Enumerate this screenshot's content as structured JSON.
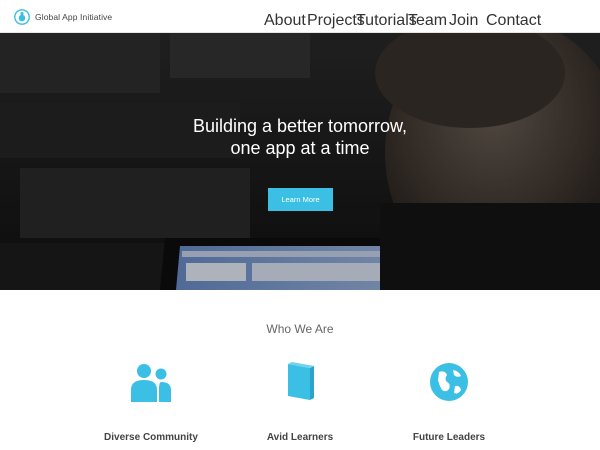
{
  "nav": {
    "brand": "Global App Initiative",
    "links": [
      "About",
      "Projects",
      "Tutorials",
      "Team",
      "Join",
      "Contact"
    ]
  },
  "hero": {
    "title_line1": "Building a better tomorrow,",
    "title_line2": "one app at a time",
    "cta_label": "Learn More"
  },
  "who": {
    "title": "Who We Are",
    "features": [
      {
        "label": "Diverse Community",
        "icon": "people-icon"
      },
      {
        "label": "Avid Learners",
        "icon": "book-icon"
      },
      {
        "label": "Future Leaders",
        "icon": "globe-icon"
      }
    ]
  },
  "colors": {
    "accent": "#3bbfe4",
    "hero_overlay": "#1e1e1e"
  }
}
